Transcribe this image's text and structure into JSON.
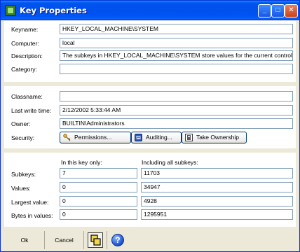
{
  "window": {
    "title": "Key Properties"
  },
  "titlebar_buttons": {
    "minimize": "_",
    "maximize": "□",
    "close": "✕"
  },
  "general": {
    "keyname_label": "Keyname:",
    "keyname_value": "HKEY_LOCAL_MACHINE\\SYSTEM",
    "computer_label": "Computer:",
    "computer_value": "local",
    "description_label": "Description:",
    "description_value": "The subkeys in HKEY_LOCAL_MACHINE\\SYSTEM store values for the current control",
    "category_label": "Category:",
    "category_value": ""
  },
  "details": {
    "classname_label": "Classname:",
    "classname_value": "",
    "last_write_label": "Last write time:",
    "last_write_value": "2/12/2002 5:33:44 AM",
    "owner_label": "Owner:",
    "owner_value": "BUILTIN\\Administrators",
    "security_label": "Security:",
    "permissions_button": "Permissions...",
    "auditing_button": "Auditing...",
    "take_ownership_button": "Take Ownership"
  },
  "stats": {
    "this_key_header": "In this key only:",
    "all_subkeys_header": "Including all subkeys:",
    "rows": [
      {
        "label": "Subkeys:",
        "this_key": "7",
        "all": "11703"
      },
      {
        "label": "Values:",
        "this_key": "0",
        "all": "34947"
      },
      {
        "label": "Largest value:",
        "this_key": "0",
        "all": "4928"
      },
      {
        "label": "Bytes in values:",
        "this_key": "0",
        "all": "1295951"
      }
    ]
  },
  "footer": {
    "ok_label": "Ok",
    "cancel_label": "Cancel",
    "help_symbol": "?"
  }
}
